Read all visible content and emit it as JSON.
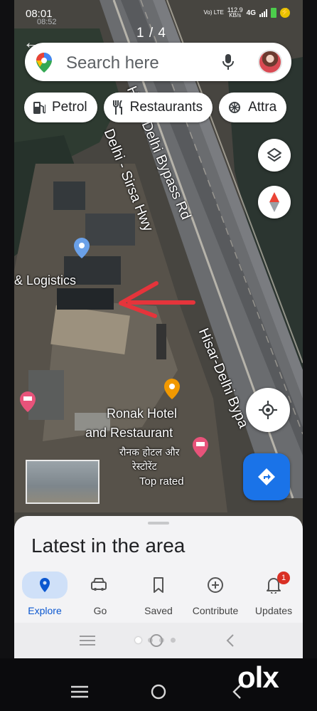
{
  "status_bar": {
    "time": "08:01",
    "inner_time": "08:52",
    "network_label": "Vo) LTE",
    "speed": "112.9",
    "speed_unit": "KB/s",
    "signal_type": "4G"
  },
  "viewer": {
    "pager": "1 / 4"
  },
  "search": {
    "placeholder": "Search here"
  },
  "chips": [
    {
      "label": "Petrol",
      "icon": "fuel-icon"
    },
    {
      "label": "Restaurants",
      "icon": "restaurant-icon"
    },
    {
      "label": "Attra",
      "icon": "attractions-icon"
    }
  ],
  "map": {
    "labels": {
      "logistics": "& Logistics",
      "hotel_line1": "Ronak Hotel",
      "hotel_line2": "and Restaurant",
      "hotel_hindi": "रौनक होटल और",
      "hotel_hindi2": "रेस्टोरेंट",
      "hotel_rating": "Top rated"
    },
    "roads": {
      "bypass_upper": "Hisar-Delhi Bypass Rd",
      "sirsa_hwy": "Delhi - Sirsa Hwy",
      "bypass_lower": "Hisar-Delhi Bypa"
    }
  },
  "sheet": {
    "title": "Latest in the area"
  },
  "bottom_nav": [
    {
      "label": "Explore",
      "icon": "explore-pin-icon",
      "active": true
    },
    {
      "label": "Go",
      "icon": "car-icon",
      "active": false
    },
    {
      "label": "Saved",
      "icon": "bookmark-icon",
      "active": false
    },
    {
      "label": "Contribute",
      "icon": "plus-circle-icon",
      "active": false
    },
    {
      "label": "Updates",
      "icon": "bell-icon",
      "active": false,
      "badge": "1"
    }
  ],
  "watermark": "olx",
  "colors": {
    "accent": "#1a73e8",
    "annotation_arrow": "#e5343b",
    "badge": "#d93025"
  }
}
